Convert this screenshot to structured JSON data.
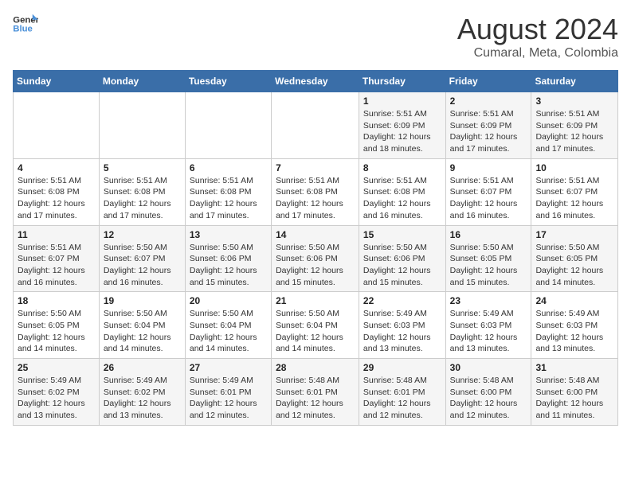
{
  "header": {
    "logo_line1": "General",
    "logo_line2": "Blue",
    "title": "August 2024",
    "subtitle": "Cumaral, Meta, Colombia"
  },
  "days_of_week": [
    "Sunday",
    "Monday",
    "Tuesday",
    "Wednesday",
    "Thursday",
    "Friday",
    "Saturday"
  ],
  "weeks": [
    [
      {
        "day": "",
        "info": ""
      },
      {
        "day": "",
        "info": ""
      },
      {
        "day": "",
        "info": ""
      },
      {
        "day": "",
        "info": ""
      },
      {
        "day": "1",
        "info": "Sunrise: 5:51 AM\nSunset: 6:09 PM\nDaylight: 12 hours\nand 18 minutes."
      },
      {
        "day": "2",
        "info": "Sunrise: 5:51 AM\nSunset: 6:09 PM\nDaylight: 12 hours\nand 17 minutes."
      },
      {
        "day": "3",
        "info": "Sunrise: 5:51 AM\nSunset: 6:09 PM\nDaylight: 12 hours\nand 17 minutes."
      }
    ],
    [
      {
        "day": "4",
        "info": "Sunrise: 5:51 AM\nSunset: 6:08 PM\nDaylight: 12 hours\nand 17 minutes."
      },
      {
        "day": "5",
        "info": "Sunrise: 5:51 AM\nSunset: 6:08 PM\nDaylight: 12 hours\nand 17 minutes."
      },
      {
        "day": "6",
        "info": "Sunrise: 5:51 AM\nSunset: 6:08 PM\nDaylight: 12 hours\nand 17 minutes."
      },
      {
        "day": "7",
        "info": "Sunrise: 5:51 AM\nSunset: 6:08 PM\nDaylight: 12 hours\nand 17 minutes."
      },
      {
        "day": "8",
        "info": "Sunrise: 5:51 AM\nSunset: 6:08 PM\nDaylight: 12 hours\nand 16 minutes."
      },
      {
        "day": "9",
        "info": "Sunrise: 5:51 AM\nSunset: 6:07 PM\nDaylight: 12 hours\nand 16 minutes."
      },
      {
        "day": "10",
        "info": "Sunrise: 5:51 AM\nSunset: 6:07 PM\nDaylight: 12 hours\nand 16 minutes."
      }
    ],
    [
      {
        "day": "11",
        "info": "Sunrise: 5:51 AM\nSunset: 6:07 PM\nDaylight: 12 hours\nand 16 minutes."
      },
      {
        "day": "12",
        "info": "Sunrise: 5:50 AM\nSunset: 6:07 PM\nDaylight: 12 hours\nand 16 minutes."
      },
      {
        "day": "13",
        "info": "Sunrise: 5:50 AM\nSunset: 6:06 PM\nDaylight: 12 hours\nand 15 minutes."
      },
      {
        "day": "14",
        "info": "Sunrise: 5:50 AM\nSunset: 6:06 PM\nDaylight: 12 hours\nand 15 minutes."
      },
      {
        "day": "15",
        "info": "Sunrise: 5:50 AM\nSunset: 6:06 PM\nDaylight: 12 hours\nand 15 minutes."
      },
      {
        "day": "16",
        "info": "Sunrise: 5:50 AM\nSunset: 6:05 PM\nDaylight: 12 hours\nand 15 minutes."
      },
      {
        "day": "17",
        "info": "Sunrise: 5:50 AM\nSunset: 6:05 PM\nDaylight: 12 hours\nand 14 minutes."
      }
    ],
    [
      {
        "day": "18",
        "info": "Sunrise: 5:50 AM\nSunset: 6:05 PM\nDaylight: 12 hours\nand 14 minutes."
      },
      {
        "day": "19",
        "info": "Sunrise: 5:50 AM\nSunset: 6:04 PM\nDaylight: 12 hours\nand 14 minutes."
      },
      {
        "day": "20",
        "info": "Sunrise: 5:50 AM\nSunset: 6:04 PM\nDaylight: 12 hours\nand 14 minutes."
      },
      {
        "day": "21",
        "info": "Sunrise: 5:50 AM\nSunset: 6:04 PM\nDaylight: 12 hours\nand 14 minutes."
      },
      {
        "day": "22",
        "info": "Sunrise: 5:49 AM\nSunset: 6:03 PM\nDaylight: 12 hours\nand 13 minutes."
      },
      {
        "day": "23",
        "info": "Sunrise: 5:49 AM\nSunset: 6:03 PM\nDaylight: 12 hours\nand 13 minutes."
      },
      {
        "day": "24",
        "info": "Sunrise: 5:49 AM\nSunset: 6:03 PM\nDaylight: 12 hours\nand 13 minutes."
      }
    ],
    [
      {
        "day": "25",
        "info": "Sunrise: 5:49 AM\nSunset: 6:02 PM\nDaylight: 12 hours\nand 13 minutes."
      },
      {
        "day": "26",
        "info": "Sunrise: 5:49 AM\nSunset: 6:02 PM\nDaylight: 12 hours\nand 13 minutes."
      },
      {
        "day": "27",
        "info": "Sunrise: 5:49 AM\nSunset: 6:01 PM\nDaylight: 12 hours\nand 12 minutes."
      },
      {
        "day": "28",
        "info": "Sunrise: 5:48 AM\nSunset: 6:01 PM\nDaylight: 12 hours\nand 12 minutes."
      },
      {
        "day": "29",
        "info": "Sunrise: 5:48 AM\nSunset: 6:01 PM\nDaylight: 12 hours\nand 12 minutes."
      },
      {
        "day": "30",
        "info": "Sunrise: 5:48 AM\nSunset: 6:00 PM\nDaylight: 12 hours\nand 12 minutes."
      },
      {
        "day": "31",
        "info": "Sunrise: 5:48 AM\nSunset: 6:00 PM\nDaylight: 12 hours\nand 11 minutes."
      }
    ]
  ]
}
